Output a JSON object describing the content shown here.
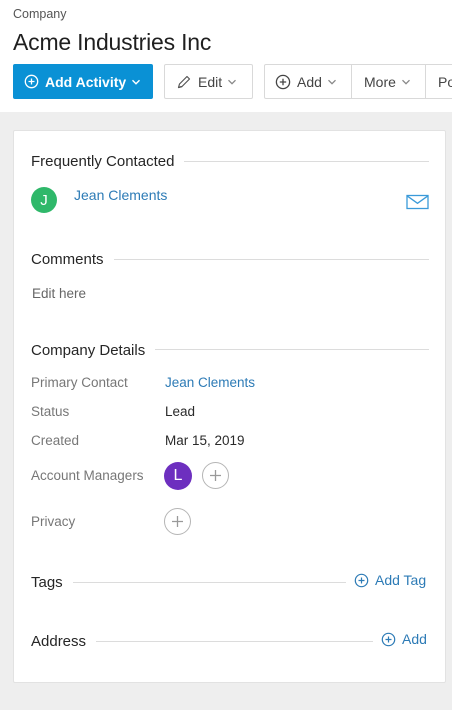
{
  "header": {
    "breadcrumb": "Company",
    "title": "Acme Industries Inc"
  },
  "toolbar": {
    "add_activity_label": "Add Activity",
    "edit_label": "Edit",
    "add_label": "Add",
    "more_label": "More",
    "partial_label": "Po"
  },
  "frequently_contacted": {
    "title": "Frequently Contacted",
    "contacts": [
      {
        "initial": "J",
        "name": "Jean Clements",
        "avatar_color": "#2fb86a"
      }
    ]
  },
  "comments": {
    "title": "Comments",
    "placeholder": "Edit here"
  },
  "company_details": {
    "title": "Company Details",
    "primary_contact_label": "Primary Contact",
    "primary_contact_value": "Jean Clements",
    "status_label": "Status",
    "status_value": "Lead",
    "created_label": "Created",
    "created_value": "Mar 15, 2019",
    "account_managers_label": "Account Managers",
    "account_manager_initial": "L",
    "account_manager_color": "#6d2fbf",
    "privacy_label": "Privacy"
  },
  "tags": {
    "title": "Tags",
    "add_label": "Add Tag"
  },
  "address": {
    "title": "Address",
    "add_label": "Add"
  },
  "colors": {
    "primary": "#0a91d5",
    "link": "#2d7bb6"
  }
}
